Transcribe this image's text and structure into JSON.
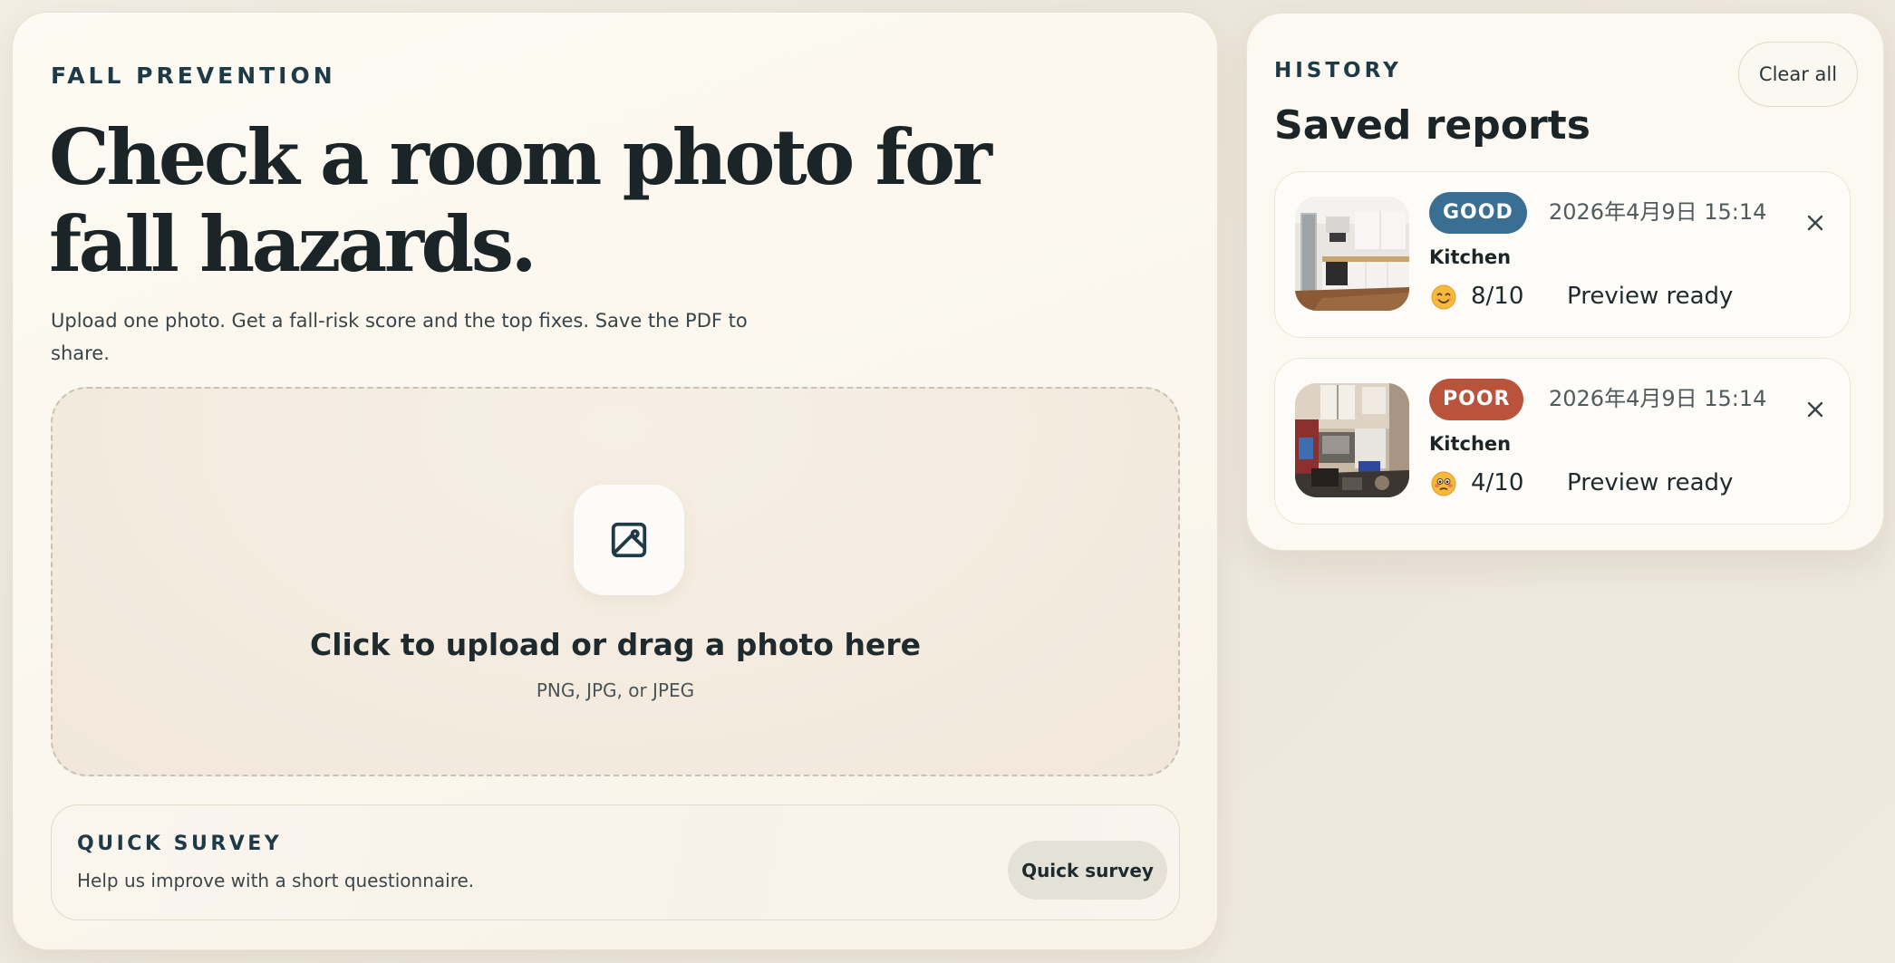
{
  "main": {
    "eyebrow": "FALL PREVENTION",
    "title": "Check a room photo for fall hazards.",
    "subtitle": "Upload one photo. Get a fall-risk score and the top fixes. Save the PDF to share."
  },
  "upload": {
    "icon": "image-icon",
    "title": "Click to upload or drag a photo here",
    "hint": "PNG, JPG, or JPEG"
  },
  "survey": {
    "eyebrow": "QUICK SURVEY",
    "description": "Help us improve with a short questionnaire.",
    "button_label": "Quick survey"
  },
  "history": {
    "eyebrow": "HISTORY",
    "title": "Saved reports",
    "clear_label": "Clear all",
    "reports": [
      {
        "rating": "GOOD",
        "rating_color": "#3a6e93",
        "timestamp": "2026年4月9日 15:14",
        "room": "Kitchen",
        "emoji": "smiling-face-icon",
        "score": "8/10",
        "status": "Preview ready"
      },
      {
        "rating": "POOR",
        "rating_color": "#b9533c",
        "timestamp": "2026年4月9日 15:14",
        "room": "Kitchen",
        "emoji": "flushed-face-icon",
        "score": "4/10",
        "status": "Preview ready"
      }
    ]
  },
  "colors": {
    "background": "#efe9df",
    "card": "#fcf9f2",
    "accent_navy": "#1e3a47",
    "good": "#3a6e93",
    "poor": "#b9533c"
  }
}
